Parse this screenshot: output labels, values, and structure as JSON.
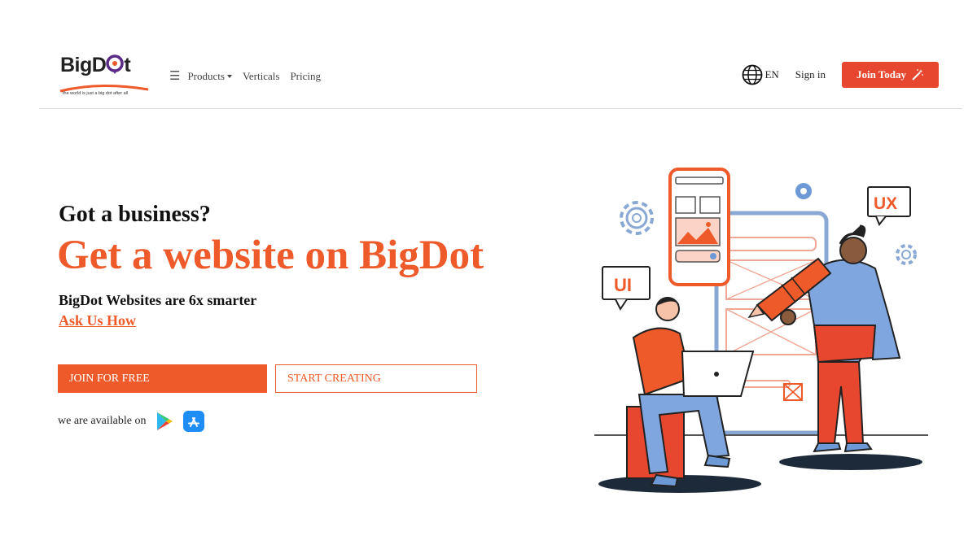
{
  "logo": {
    "text": "BigDot",
    "tagline": "the world is just a big dot after all"
  },
  "nav": {
    "items": [
      {
        "label": "Products",
        "dropdown": true
      },
      {
        "label": "Verticals",
        "dropdown": false
      },
      {
        "label": "Pricing",
        "dropdown": false
      }
    ]
  },
  "header_right": {
    "language": "EN",
    "sign_in": "Sign in",
    "join_today": "Join Today"
  },
  "hero": {
    "line1": "Got a business?",
    "line2": "Get a website on BigDot",
    "subtitle": "BigDot Websites are 6x smarter",
    "link": "Ask Us How"
  },
  "buttons": {
    "join_free": "JOIN FOR FREE",
    "start_creating": "START CREATING"
  },
  "availability": {
    "text": "we are available on",
    "stores": [
      "google-play-icon",
      "app-store-icon"
    ]
  },
  "illustration": {
    "badge_ui": "UI",
    "badge_ux": "UX"
  },
  "colors": {
    "brand": "#ee5a2a",
    "cta": "#e8472f",
    "logo_dot": "#5b2a86"
  }
}
